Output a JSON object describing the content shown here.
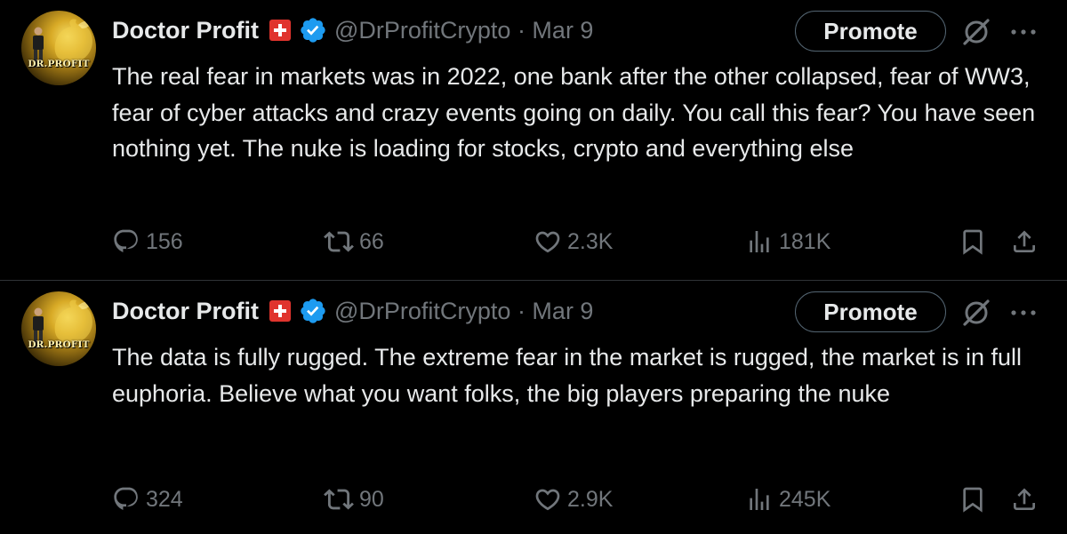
{
  "colors": {
    "background": "#000000",
    "text": "#e7e9ea",
    "muted": "#71767b",
    "verified": "#1d9bf0",
    "flag_red": "#e0342d",
    "divider": "#2f3336"
  },
  "tweets": [
    {
      "author": {
        "name": "Doctor Profit",
        "handle_line": "@DrProfitCrypto · Mar 9",
        "avatar_text": "DR.PROFIT",
        "flag": "swiss-flag-icon",
        "badge": "verified-badge-icon"
      },
      "promote_label": "Promote",
      "text": "The real fear in markets was in 2022, one bank after the other collapsed, fear of WW3, fear of cyber attacks and crazy events going on daily. You call this fear? You have seen nothing yet. The nuke is loading for stocks, crypto and everything else",
      "stats": {
        "replies": "156",
        "retweets": "66",
        "likes": "2.3K",
        "views": "181K"
      }
    },
    {
      "author": {
        "name": "Doctor Profit",
        "handle_line": "@DrProfitCrypto · Mar 9",
        "avatar_text": "DR.PROFIT",
        "flag": "swiss-flag-icon",
        "badge": "verified-badge-icon"
      },
      "promote_label": "Promote",
      "text": "The data is fully rugged. The extreme fear in the market is rugged, the market is in full euphoria. Believe what you want folks, the big players preparing the nuke",
      "stats": {
        "replies": "324",
        "retweets": "90",
        "likes": "2.9K",
        "views": "245K"
      }
    }
  ]
}
